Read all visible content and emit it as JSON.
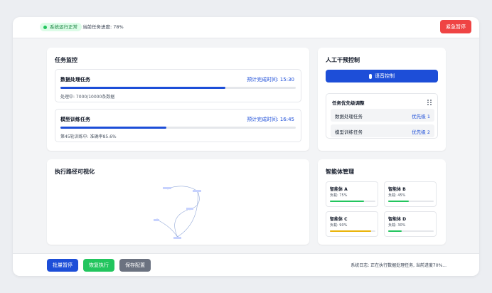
{
  "topbar": {
    "status_label": "系统运行正常",
    "progress_label": "当前任务进度: 78%",
    "stop_label": "紧急暂停"
  },
  "monitor": {
    "title": "任务监控",
    "tasks": [
      {
        "name": "数据处理任务",
        "eta": "预计完成时间: 15:30",
        "detail": "处理中: 7000/10000条数据",
        "progress": 0.7
      },
      {
        "name": "模型训练任务",
        "eta": "预计完成时间: 16:45",
        "detail": "第45轮训练中: 准确率85.6%",
        "progress": 0.45
      }
    ]
  },
  "control": {
    "title": "人工干预控制",
    "voice_label": "语音控制",
    "priority": {
      "title": "任务优先级调整",
      "rows": [
        {
          "label": "数据处理任务",
          "value": "优先级 1"
        },
        {
          "label": "模型训练任务",
          "value": "优先级 2"
        }
      ]
    }
  },
  "path": {
    "title": "执行路径可视化"
  },
  "agents": {
    "title": "智能体管理",
    "items": [
      {
        "name": "智能体 A",
        "load_label": "负载: 75%",
        "load": 0.75,
        "color": "#22c55e"
      },
      {
        "name": "智能体 B",
        "load_label": "负载: 45%",
        "load": 0.45,
        "color": "#22c55e"
      },
      {
        "name": "智能体 C",
        "load_label": "负载: 90%",
        "load": 0.9,
        "color": "#eab308"
      },
      {
        "name": "智能体 D",
        "load_label": "负载: 30%",
        "load": 0.3,
        "color": "#22c55e"
      }
    ]
  },
  "bottombar": {
    "pause_all_label": "批量暂停",
    "resume_label": "恢复执行",
    "save_label": "保存配置",
    "log_text": "系统日志: 正在执行数据处理任务, 当前进度70%..."
  },
  "colors": {
    "accent": "#1d4ed8",
    "danger": "#ef4444",
    "success": "#22c55e",
    "neutral": "#6b7280"
  }
}
